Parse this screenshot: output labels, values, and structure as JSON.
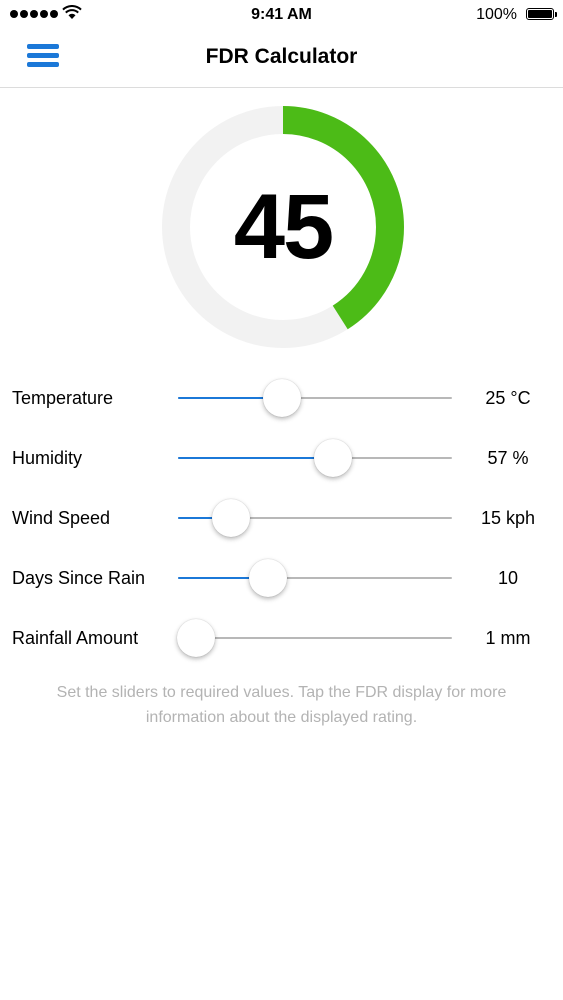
{
  "status_bar": {
    "time": "9:41 AM",
    "battery": "100%"
  },
  "nav": {
    "title": "FDR Calculator",
    "menu_icon": "hamburger-menu-icon"
  },
  "gauge": {
    "value": "45",
    "level": 0.41,
    "color": "#4cbb17",
    "track_color": "#f2f2f2"
  },
  "accent_color": "#1b78d8",
  "sliders": [
    {
      "label": "Temperature",
      "value": "25 °C",
      "fraction": 0.38
    },
    {
      "label": "Humidity",
      "value": "57 %",
      "fraction": 0.565
    },
    {
      "label": "Wind Speed",
      "value": "15 kph",
      "fraction": 0.195
    },
    {
      "label": "Days Since Rain",
      "value": "10",
      "fraction": 0.33
    },
    {
      "label": "Rainfall Amount",
      "value": "1 mm",
      "fraction": 0.065
    }
  ],
  "hint": {
    "line1": "Set the sliders to required values. Tap the FDR display for more",
    "line2": "information about the displayed rating."
  }
}
